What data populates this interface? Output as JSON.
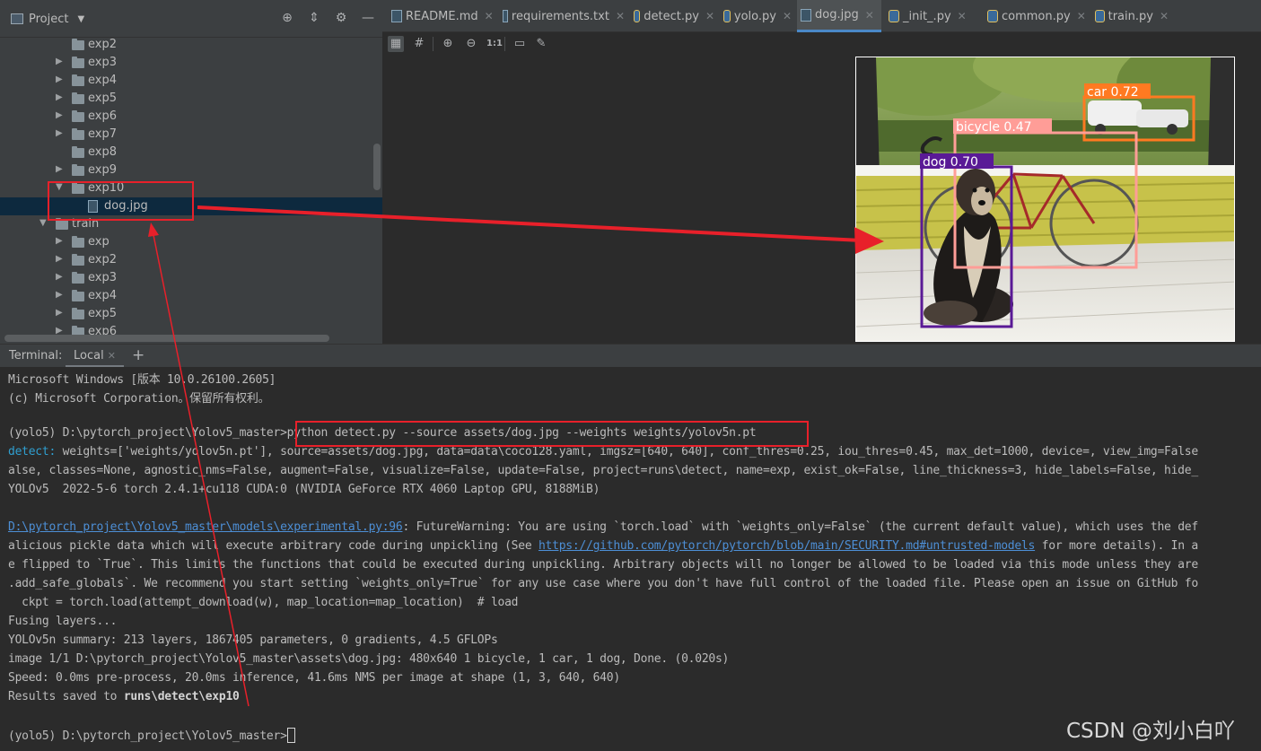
{
  "project": {
    "title": "Project",
    "header_icons": [
      "crosshair-icon",
      "collapse-icon",
      "gear-icon",
      "minimize-icon"
    ],
    "tree": [
      {
        "label": "exp2",
        "depth": 2,
        "type": "folder",
        "arrow": ""
      },
      {
        "label": "exp3",
        "depth": 2,
        "type": "folder",
        "arrow": "▶"
      },
      {
        "label": "exp4",
        "depth": 2,
        "type": "folder",
        "arrow": "▶"
      },
      {
        "label": "exp5",
        "depth": 2,
        "type": "folder",
        "arrow": "▶"
      },
      {
        "label": "exp6",
        "depth": 2,
        "type": "folder",
        "arrow": "▶"
      },
      {
        "label": "exp7",
        "depth": 2,
        "type": "folder",
        "arrow": "▶"
      },
      {
        "label": "exp8",
        "depth": 2,
        "type": "folder",
        "arrow": ""
      },
      {
        "label": "exp9",
        "depth": 2,
        "type": "folder",
        "arrow": "▶"
      },
      {
        "label": "exp10",
        "depth": 2,
        "type": "folder",
        "arrow": "▼"
      },
      {
        "label": "dog.jpg",
        "depth": 3,
        "type": "file",
        "arrow": "",
        "selected": true
      },
      {
        "label": "train",
        "depth": 1,
        "type": "folder",
        "arrow": "▼"
      },
      {
        "label": "exp",
        "depth": 2,
        "type": "folder",
        "arrow": "▶"
      },
      {
        "label": "exp2",
        "depth": 2,
        "type": "folder",
        "arrow": "▶"
      },
      {
        "label": "exp3",
        "depth": 2,
        "type": "folder",
        "arrow": "▶"
      },
      {
        "label": "exp4",
        "depth": 2,
        "type": "folder",
        "arrow": "▶"
      },
      {
        "label": "exp5",
        "depth": 2,
        "type": "folder",
        "arrow": "▶"
      },
      {
        "label": "exp6",
        "depth": 2,
        "type": "folder",
        "arrow": "▶"
      }
    ]
  },
  "editor": {
    "tabs": [
      {
        "label": "README.md",
        "kind": "md"
      },
      {
        "label": "requirements.txt",
        "kind": "txt"
      },
      {
        "label": "detect.py",
        "kind": "py"
      },
      {
        "label": "yolo.py",
        "kind": "py"
      },
      {
        "label": "dog.jpg",
        "kind": "img",
        "active": true
      },
      {
        "label": "_init_.py",
        "kind": "py"
      },
      {
        "label": "common.py",
        "kind": "py"
      },
      {
        "label": "train.py",
        "kind": "py"
      }
    ],
    "toolbar": [
      {
        "name": "chessboard-icon",
        "glyph": "▦",
        "active": true
      },
      {
        "name": "grid-icon",
        "glyph": "#"
      },
      {
        "name": "zoom-in-icon",
        "glyph": "⊕"
      },
      {
        "name": "zoom-out-icon",
        "glyph": "⊖"
      },
      {
        "name": "actual-size-icon",
        "glyph": "1:1"
      },
      {
        "name": "fit-icon",
        "glyph": "▭"
      },
      {
        "name": "color-picker-icon",
        "glyph": "✎"
      }
    ],
    "detections": [
      {
        "label": "car 0.72",
        "color": "#ff7a21"
      },
      {
        "label": "bicycle 0.47",
        "color": "#ff9d97"
      },
      {
        "label": "dog 0.70",
        "color": "#5a1a96"
      }
    ]
  },
  "terminal": {
    "title": "Terminal:",
    "tab": "Local",
    "lines": [
      {
        "segments": [
          {
            "t": "Microsoft Windows [版本 10.0.26100.2605]"
          }
        ]
      },
      {
        "segments": [
          {
            "t": "(c) Microsoft Corporation。保留所有权利。"
          }
        ]
      },
      {
        "segments": [
          {
            "t": ""
          }
        ]
      },
      {
        "segments": [
          {
            "t": "(yolo5) D:\\pytorch_project\\Yolov5_master>"
          },
          {
            "t": "python detect.py --source assets/dog.jpg --weights weights/yolov5n.pt"
          }
        ]
      },
      {
        "segments": [
          {
            "t": "detect: ",
            "cls": "cyan"
          },
          {
            "t": "weights=['weights/yolov5n.pt'], source=assets/dog.jpg, data=data\\coco128.yaml, imgsz=[640, 640], conf_thres=0.25, iou_thres=0.45, max_det=1000, device=, view_img=False"
          }
        ]
      },
      {
        "segments": [
          {
            "t": "alse, classes=None, agnostic_nms=False, augment=False, visualize=False, update=False, project=runs\\detect, name=exp, exist_ok=False, line_thickness=3, hide_labels=False, hide_"
          }
        ]
      },
      {
        "segments": [
          {
            "t": "YOLOv5  2022-5-6 torch 2.4.1+cu118 CUDA:0 (NVIDIA GeForce RTX 4060 Laptop GPU, 8188MiB)"
          }
        ]
      },
      {
        "segments": [
          {
            "t": ""
          }
        ]
      },
      {
        "segments": [
          {
            "t": "D:\\pytorch_project\\Yolov5_master\\models\\experimental.py:96",
            "cls": "link"
          },
          {
            "t": ": FutureWarning: You are using `torch.load` with `weights_only=False` (the current default value), which uses the def"
          }
        ]
      },
      {
        "segments": [
          {
            "t": "alicious pickle data which will execute arbitrary code during unpickling (See "
          },
          {
            "t": "https://github.com/pytorch/pytorch/blob/main/SECURITY.md#untrusted-models",
            "cls": "link"
          },
          {
            "t": " for more details). In a"
          }
        ]
      },
      {
        "segments": [
          {
            "t": "e flipped to `True`. This limits the functions that could be executed during unpickling. Arbitrary objects will no longer be allowed to be loaded via this mode unless they are"
          }
        ]
      },
      {
        "segments": [
          {
            "t": ".add_safe_globals`. We recommend you start setting `weights_only=True` for any use case where you don't have full control of the loaded file. Please open an issue on GitHub fo"
          }
        ]
      },
      {
        "segments": [
          {
            "t": "  ckpt = torch.load(attempt_download(w), map_location=map_location)  # load"
          }
        ]
      },
      {
        "segments": [
          {
            "t": "Fusing layers... "
          }
        ]
      },
      {
        "segments": [
          {
            "t": "YOLOv5n summary: 213 layers, 1867405 parameters, 0 gradients, 4.5 GFLOPs"
          }
        ]
      },
      {
        "segments": [
          {
            "t": "image 1/1 D:\\pytorch_project\\Yolov5_master\\assets\\dog.jpg: 480x640 1 bicycle, 1 car, 1 dog, Done. (0.020s)"
          }
        ]
      },
      {
        "segments": [
          {
            "t": "Speed: 0.0ms pre-process, 20.0ms inference, 41.6ms NMS per image at shape (1, 3, 640, 640)"
          }
        ]
      },
      {
        "segments": [
          {
            "t": "Results saved to "
          },
          {
            "t": "runs\\detect\\exp10",
            "cls": "bold"
          }
        ]
      },
      {
        "segments": [
          {
            "t": ""
          }
        ]
      },
      {
        "segments": [
          {
            "t": "(yolo5) D:\\pytorch_project\\Yolov5_master>"
          }
        ],
        "cursor": true
      }
    ]
  },
  "watermark": "CSDN @刘小白吖",
  "colors": {
    "annotation_red": "#e8202a",
    "accent_blue": "#4a88c7",
    "selection": "#0d293e"
  }
}
